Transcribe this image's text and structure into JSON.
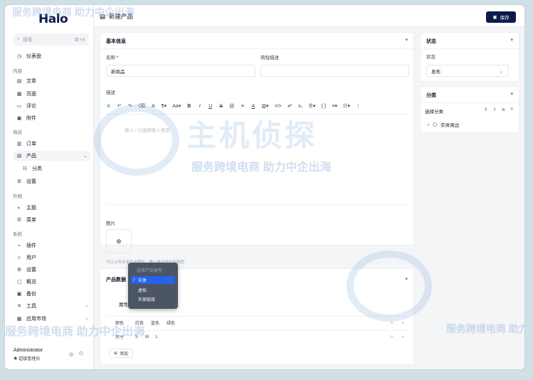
{
  "app": {
    "logo": "Halo"
  },
  "sidebar": {
    "search_placeholder": "搜索",
    "search_shortcut": "⌘+K",
    "dashboard": "仪表盘",
    "groups": {
      "content": "内容",
      "store": "商店",
      "appearance": "外观",
      "system": "系统"
    },
    "items": {
      "posts": "文章",
      "pages": "页面",
      "comments": "评论",
      "attachments": "附件",
      "orders": "订单",
      "products": "产品",
      "categories": "分类",
      "store_settings": "设置",
      "themes": "主题",
      "menus": "菜单",
      "plugins": "插件",
      "users": "用户",
      "settings": "设置",
      "overview": "概览",
      "backup": "备份",
      "tools": "工具",
      "app_market": "应用市场"
    },
    "user": {
      "name": "Administrator",
      "role": "超级管理员"
    }
  },
  "header": {
    "title": "新建产品",
    "save_label": "保存"
  },
  "basic_info": {
    "title": "基本信息",
    "name_label": "名称 *",
    "name_value": "新商品",
    "short_desc_label": "简短描述",
    "short_desc_value": "",
    "desc_label": "描述",
    "editor_placeholder": "输入 / 以选择输入类型",
    "toolbar": [
      "⊕",
      "↶",
      "↷",
      "⌫",
      "A",
      "¶▾",
      "Aa▾",
      "B",
      "I",
      "U",
      "S",
      "@",
      "≡",
      "A",
      "▥▾",
      "</>",
      "x²",
      "x₂",
      "☰▾",
      "{ }",
      "≡▾",
      "☷▾",
      "⋮"
    ],
    "image_label": "图片",
    "image_hint": "可以上传多张产品图片，第一张会作为封面图"
  },
  "product_data": {
    "title": "产品数据",
    "type_options_header": "选择产品类型",
    "type_options": [
      "实体",
      "虚拟",
      "外部链接"
    ],
    "selected_type": "实体",
    "attributes_tab": "属性",
    "attributes": [
      {
        "name": "颜色",
        "values": [
          "红色",
          "蓝色",
          "绿色"
        ]
      },
      {
        "name": "尺寸",
        "values": [
          "S",
          "M",
          "L"
        ]
      }
    ],
    "add_label": "添加"
  },
  "status_card": {
    "title": "状态",
    "label": "状态",
    "value": "发布"
  },
  "category_card": {
    "title": "分类",
    "select_label": "选择分类",
    "tree_item": "实体周边"
  },
  "watermark": {
    "cn": "服务跨境电商  助力中企出海",
    "brand": "主机侦探"
  },
  "colors": {
    "primary": "#0b1a4a",
    "selected": "#2563eb"
  }
}
